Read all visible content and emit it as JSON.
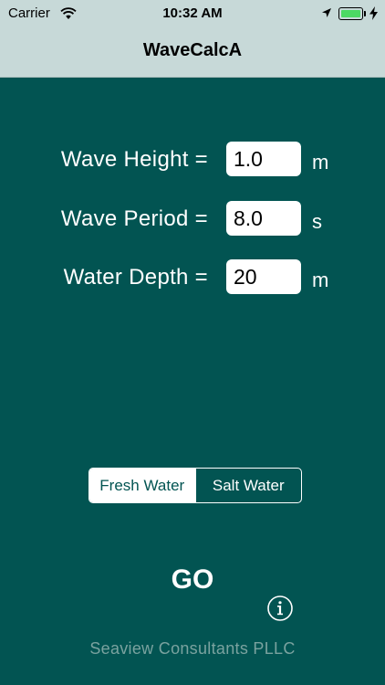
{
  "status_bar": {
    "carrier": "Carrier",
    "time": "10:32 AM",
    "battery_level": 1.0,
    "icons": [
      "wifi-icon",
      "location-icon",
      "battery-icon",
      "charging-icon"
    ]
  },
  "nav": {
    "title": "WaveCalcA"
  },
  "fields": [
    {
      "label": "Wave Height =",
      "value": "1.0",
      "unit": "m"
    },
    {
      "label": "Wave Period =",
      "value": "8.0",
      "unit": "s"
    },
    {
      "label": "Water Depth =",
      "value": "20",
      "unit": "m"
    }
  ],
  "water_type": {
    "options": [
      "Fresh Water",
      "Salt Water"
    ],
    "selected": "Fresh Water"
  },
  "go_label": "GO",
  "info_icon": "info-icon",
  "footer": "Seaview Consultants PLLC",
  "colors": {
    "background": "#025452",
    "bar": "#c7d9d8",
    "footer_text": "#7aa29f",
    "battery_fill": "#4cd964"
  }
}
